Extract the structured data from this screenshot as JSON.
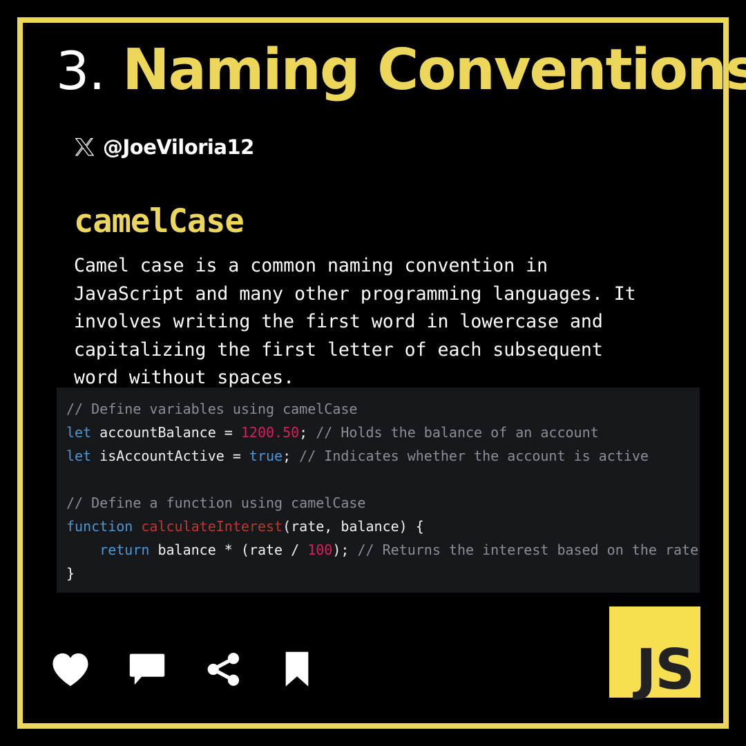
{
  "card": {
    "border_color": "#edd75b",
    "background_color": "#000000"
  },
  "header": {
    "number": "3.",
    "title": "Naming Conventions"
  },
  "author": {
    "platform_icon": "x-logo-icon",
    "handle": "@JoeViloria12"
  },
  "content": {
    "subheading": "camelCase",
    "paragraph": "Camel case is a common naming convention in\nJavaScript and many other programming languages. It\ninvolves writing the first word in lowercase and\ncapitalizing the first letter of each subsequent\nword without spaces."
  },
  "code": {
    "language": "javascript",
    "background_color": "#16181b",
    "lines": [
      [
        {
          "t": "// Define variables using camelCase",
          "c": "comment"
        }
      ],
      [
        {
          "t": "let",
          "c": "keyword"
        },
        {
          "t": " accountBalance = ",
          "c": "plain"
        },
        {
          "t": "1200.50",
          "c": "number"
        },
        {
          "t": "; ",
          "c": "plain"
        },
        {
          "t": "// Holds the balance of an account",
          "c": "comment"
        }
      ],
      [
        {
          "t": "let",
          "c": "keyword"
        },
        {
          "t": " isAccountActive = ",
          "c": "plain"
        },
        {
          "t": "true",
          "c": "bool"
        },
        {
          "t": "; ",
          "c": "plain"
        },
        {
          "t": "// Indicates whether the account is active",
          "c": "comment"
        }
      ],
      [
        {
          "t": "",
          "c": "plain"
        }
      ],
      [
        {
          "t": "// Define a function using camelCase",
          "c": "comment"
        }
      ],
      [
        {
          "t": "function",
          "c": "keyword"
        },
        {
          "t": " ",
          "c": "plain"
        },
        {
          "t": "calculateInterest",
          "c": "func"
        },
        {
          "t": "(rate, balance) {",
          "c": "plain"
        }
      ],
      [
        {
          "t": "    ",
          "c": "plain"
        },
        {
          "t": "return",
          "c": "keyword"
        },
        {
          "t": " balance * (rate / ",
          "c": "plain"
        },
        {
          "t": "100",
          "c": "number"
        },
        {
          "t": "); ",
          "c": "plain"
        },
        {
          "t": "// Returns the interest based on the rate",
          "c": "comment"
        }
      ],
      [
        {
          "t": "}",
          "c": "plain"
        }
      ]
    ]
  },
  "actions": [
    {
      "name": "like-icon",
      "label": "Like"
    },
    {
      "name": "comment-icon",
      "label": "Comment"
    },
    {
      "name": "share-icon",
      "label": "Share"
    },
    {
      "name": "bookmark-icon",
      "label": "Bookmark"
    }
  ],
  "badge": {
    "text": "JS",
    "background_color": "#f7df51",
    "text_color": "#222222"
  },
  "colors": {
    "accent_yellow": "#edd75b",
    "keyword_blue": "#4d97d6",
    "number_pink": "#d81e5b",
    "function_red": "#c4362c",
    "comment_gray": "#8a8f93"
  }
}
